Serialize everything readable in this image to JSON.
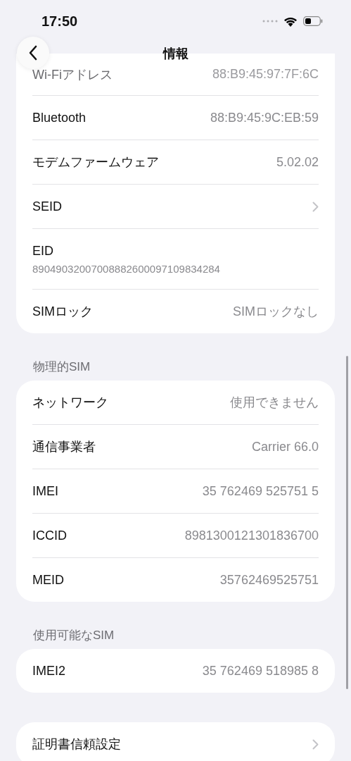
{
  "status_bar": {
    "time": "17:50"
  },
  "nav": {
    "title": "情報"
  },
  "sections": [
    {
      "rows": [
        {
          "kind": "value",
          "label": "Wi-Fiアドレス",
          "value": "88:B9:45:97:7F:6C",
          "faded": true
        },
        {
          "kind": "value",
          "label": "Bluetooth",
          "value": "88:B9:45:9C:EB:59",
          "faded": false
        },
        {
          "kind": "value",
          "label": "モデムファームウェア",
          "value": "5.02.02",
          "faded": false
        },
        {
          "kind": "chevron",
          "label": "SEID",
          "faded": false
        },
        {
          "kind": "stacked",
          "label": "EID",
          "value": "89049032007008882600097109834284",
          "faded": false
        },
        {
          "kind": "value",
          "label": "SIMロック",
          "value": "SIMロックなし",
          "faded": false
        }
      ]
    },
    {
      "header": "物理的SIM",
      "rows": [
        {
          "kind": "value",
          "label": "ネットワーク",
          "value": "使用できません"
        },
        {
          "kind": "value",
          "label": "通信事業者",
          "value": "Carrier 66.0"
        },
        {
          "kind": "value",
          "label": "IMEI",
          "value": "35 762469 525751 5"
        },
        {
          "kind": "value",
          "label": "ICCID",
          "value": "8981300121301836700"
        },
        {
          "kind": "value",
          "label": "MEID",
          "value": "35762469525751"
        }
      ]
    },
    {
      "header": "使用可能なSIM",
      "rows": [
        {
          "kind": "value",
          "label": "IMEI2",
          "value": "35 762469 518985 8"
        }
      ]
    },
    {
      "rows": [
        {
          "kind": "chevron",
          "label": "証明書信頼設定"
        }
      ]
    }
  ]
}
